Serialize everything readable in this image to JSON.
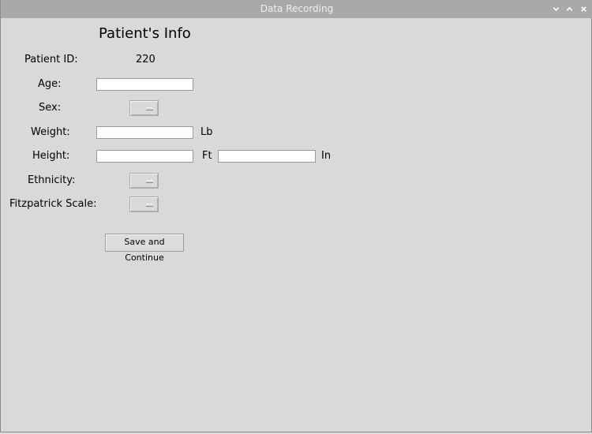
{
  "window": {
    "title": "Data Recording",
    "controls": [
      "minimize-icon",
      "maximize-icon",
      "close-icon"
    ]
  },
  "form": {
    "heading": "Patient's Info",
    "patient_id": {
      "label": "Patient ID:",
      "value": "220"
    },
    "age": {
      "label": "Age:",
      "value": ""
    },
    "sex": {
      "label": "Sex:",
      "selected": ""
    },
    "weight": {
      "label": "Weight:",
      "value": "",
      "unit": "Lb"
    },
    "height": {
      "label": "Height:",
      "feet_value": "",
      "feet_unit": "Ft",
      "inches_value": "",
      "inches_unit": "In"
    },
    "ethnicity": {
      "label": "Ethnicity:",
      "selected": ""
    },
    "fitzpatrick": {
      "label": "Fitzpatrick Scale:",
      "selected": ""
    },
    "save_button_label": "Save and Continue"
  },
  "colors": {
    "window_bg": "#d9d9d9",
    "titlebar_bg": "#a9a9a9",
    "titlebar_text": "#f0f0f0"
  }
}
